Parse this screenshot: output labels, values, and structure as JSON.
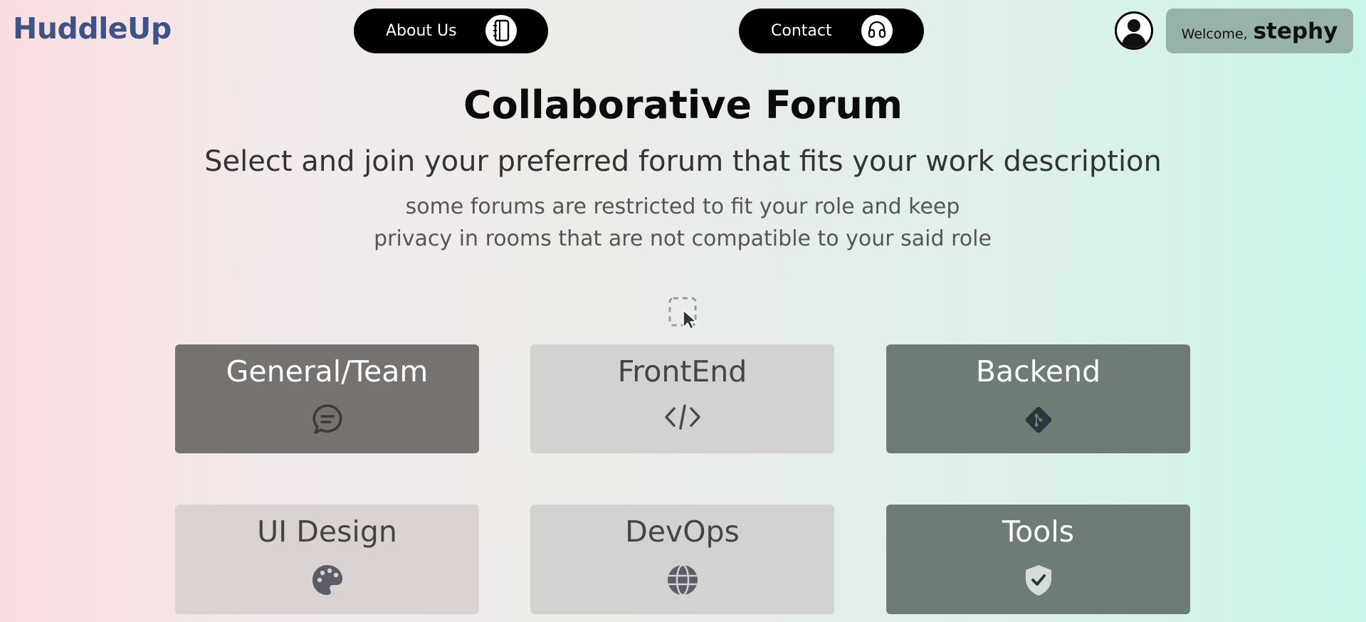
{
  "header": {
    "logo": "HuddleUp",
    "about_label": "About Us",
    "contact_label": "Contact",
    "welcome_prefix": "Welcome,",
    "username": "stephy"
  },
  "main": {
    "title": "Collaborative Forum",
    "subtitle": "Select and join your preferred forum that fits your work description",
    "note": "some forums are restricted to fit your role and keep privacy in rooms that are not compatible to your said role"
  },
  "forums": [
    {
      "label": "General/Team",
      "icon": "chat-icon"
    },
    {
      "label": "FrontEnd",
      "icon": "code-icon"
    },
    {
      "label": "Backend",
      "icon": "git-icon"
    },
    {
      "label": "UI Design",
      "icon": "palette-icon"
    },
    {
      "label": "DevOps",
      "icon": "globe-icon"
    },
    {
      "label": "Tools",
      "icon": "shield-check-icon"
    }
  ],
  "colors": {
    "logo": "#3d5386",
    "welcome_bg": "#98b1aa",
    "card_dark": "#6f7b75",
    "card_gray": "#757270",
    "card_light": "#d2d3d0"
  }
}
